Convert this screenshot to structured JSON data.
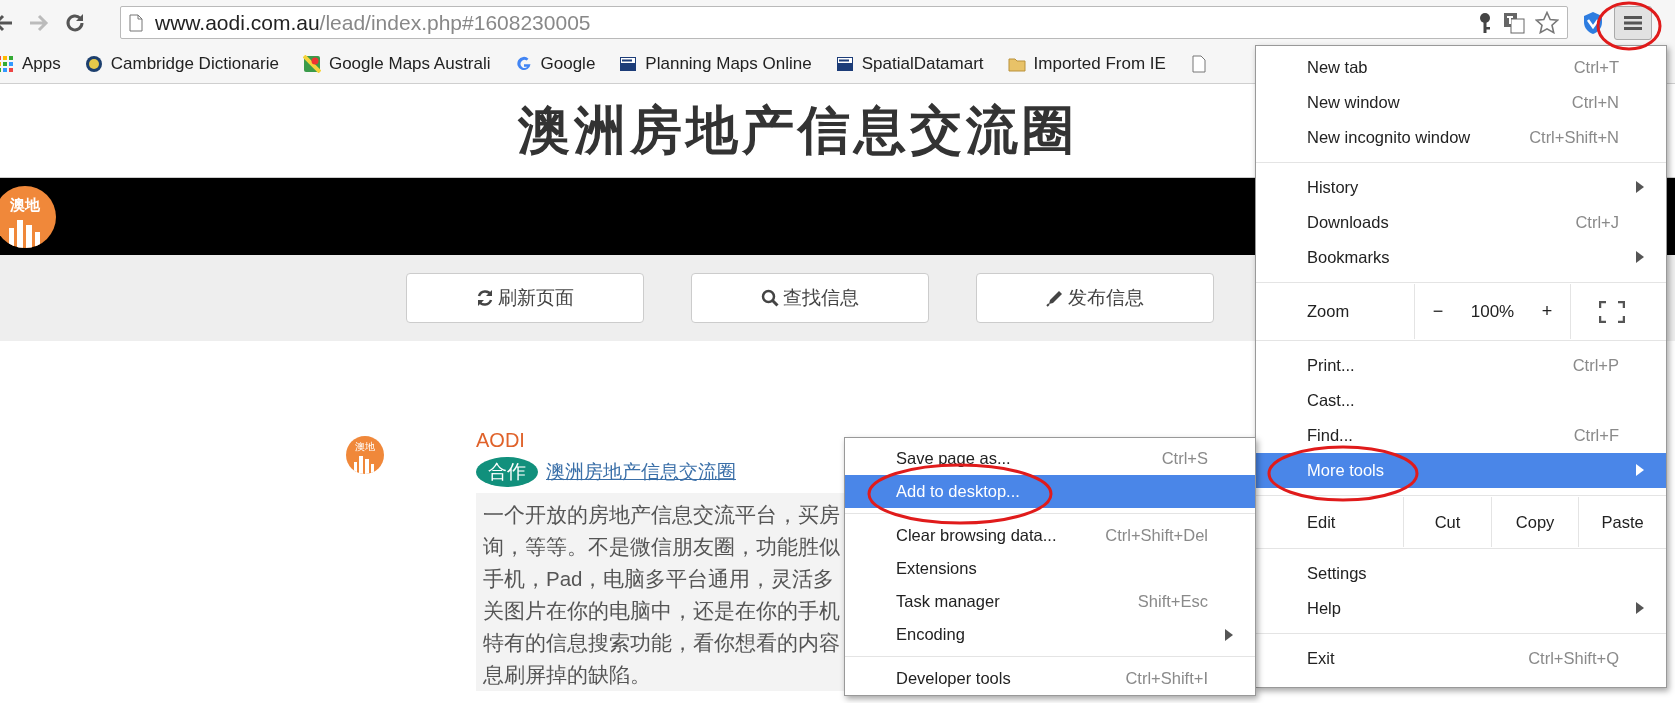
{
  "toolbar": {
    "url_host": "www.aodi.com.au",
    "url_path": "/lead/index.php#1608230005",
    "menu_button_circled": true
  },
  "bookmarks": [
    {
      "kind": "apps",
      "label": "Apps"
    },
    {
      "kind": "circle",
      "label": "Cambridge Dictionarie"
    },
    {
      "kind": "maps",
      "label": "Google Maps Australi"
    },
    {
      "kind": "google",
      "label": "Google"
    },
    {
      "kind": "land",
      "label": "Planning Maps Online"
    },
    {
      "kind": "land",
      "label": "SpatialDatamart"
    },
    {
      "kind": "folder",
      "label": "Imported From IE"
    },
    {
      "kind": "page"
    }
  ],
  "site": {
    "title": "澳洲房地产信息交流圈",
    "logo_text": "澳地",
    "actions": [
      {
        "kind": "refresh",
        "label": "刷新页面"
      },
      {
        "kind": "search",
        "label": "查找信息"
      },
      {
        "kind": "edit",
        "label": "发布信息"
      }
    ]
  },
  "post": {
    "avatar_text": "澳地",
    "author": "AODI",
    "tag": "合作",
    "title": "澳洲房地产信息交流圈",
    "lines": [
      "一个开放的房地产信息交流平台，买房",
      "询，等等。不是微信朋友圈，功能胜似",
      "手机，Pad，电脑多平台通用，灵活多",
      "关图片在你的电脑中，还是在你的手机",
      "特有的信息搜索功能，看你想看的内容",
      "息刷屏掉的缺陷。"
    ]
  },
  "menu": {
    "sections": [
      {
        "items": [
          {
            "kind": "item",
            "label": "New tab",
            "shortcut": "Ctrl+T",
            "submenu": false,
            "highlighted": false,
            "circled": false
          },
          {
            "kind": "item",
            "label": "New window",
            "shortcut": "Ctrl+N",
            "submenu": false,
            "highlighted": false,
            "circled": false
          },
          {
            "kind": "item",
            "label": "New incognito window",
            "shortcut": "Ctrl+Shift+N",
            "submenu": false,
            "highlighted": false,
            "circled": false
          }
        ]
      },
      {
        "items": [
          {
            "kind": "item",
            "label": "History",
            "submenu": true,
            "highlighted": false,
            "circled": false
          },
          {
            "kind": "item",
            "label": "Downloads",
            "shortcut": "Ctrl+J",
            "submenu": false,
            "highlighted": false,
            "circled": false
          },
          {
            "kind": "item",
            "label": "Bookmarks",
            "submenu": true,
            "highlighted": false,
            "circled": false
          }
        ]
      },
      {
        "items": [
          {
            "kind": "zoom",
            "label": "Zoom",
            "minus": "−",
            "value": "100%",
            "plus": "+"
          }
        ]
      },
      {
        "items": [
          {
            "kind": "item",
            "label": "Print...",
            "shortcut": "Ctrl+P",
            "submenu": false,
            "highlighted": false,
            "circled": false
          },
          {
            "kind": "item",
            "label": "Cast...",
            "submenu": false,
            "highlighted": false,
            "circled": false
          },
          {
            "kind": "item",
            "label": "Find...",
            "shortcut": "Ctrl+F",
            "submenu": false,
            "highlighted": false,
            "circled": false
          },
          {
            "kind": "item",
            "label": "More tools",
            "submenu": true,
            "highlighted": true,
            "circled": true
          }
        ]
      },
      {
        "items": [
          {
            "kind": "edit",
            "label": "Edit",
            "buttons": [
              "Cut",
              "Copy",
              "Paste"
            ]
          }
        ]
      },
      {
        "items": [
          {
            "kind": "item",
            "label": "Settings",
            "submenu": false,
            "highlighted": false,
            "circled": false
          },
          {
            "kind": "item",
            "label": "Help",
            "submenu": true,
            "highlighted": false,
            "circled": false
          }
        ]
      },
      {
        "items": [
          {
            "kind": "item",
            "label": "Exit",
            "shortcut": "Ctrl+Shift+Q",
            "submenu": false,
            "highlighted": false,
            "circled": false
          }
        ]
      }
    ]
  },
  "submenu": {
    "sections": [
      {
        "items": [
          {
            "kind": "item",
            "label": "Save page as...",
            "shortcut": "Ctrl+S",
            "submenu": false,
            "highlighted": false,
            "circled": false
          },
          {
            "kind": "item",
            "label": "Add to desktop...",
            "submenu": false,
            "highlighted": true,
            "circled": true
          }
        ]
      },
      {
        "items": [
          {
            "kind": "item",
            "label": "Clear browsing data...",
            "shortcut": "Ctrl+Shift+Del",
            "submenu": false,
            "highlighted": false,
            "circled": false
          },
          {
            "kind": "item",
            "label": "Extensions",
            "submenu": false,
            "highlighted": false,
            "circled": false
          },
          {
            "kind": "item",
            "label": "Task manager",
            "shortcut": "Shift+Esc",
            "submenu": false,
            "highlighted": false,
            "circled": false
          },
          {
            "kind": "item",
            "label": "Encoding",
            "submenu": true,
            "highlighted": false,
            "circled": false
          }
        ]
      },
      {
        "items": [
          {
            "kind": "item",
            "label": "Developer tools",
            "shortcut": "Ctrl+Shift+I",
            "submenu": false,
            "highlighted": false,
            "circled": false
          }
        ]
      }
    ]
  }
}
